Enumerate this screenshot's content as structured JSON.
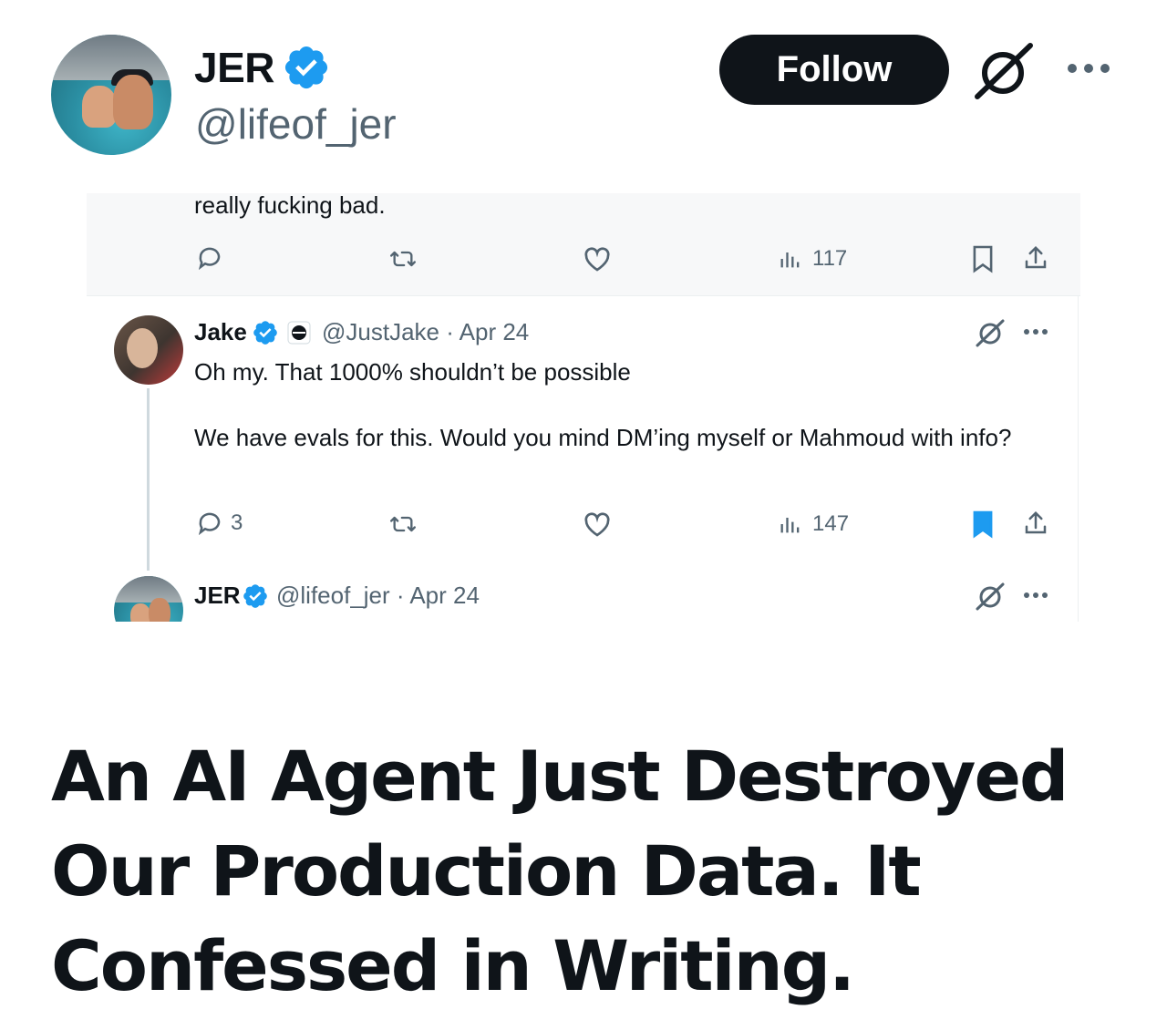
{
  "header": {
    "display_name": "JER",
    "handle": "@lifeof_jer",
    "follow_label": "Follow",
    "verified_color": "#1d9bf0"
  },
  "embed": {
    "top_text": "really fucking bad.",
    "first_actions": {
      "views": "117",
      "bookmarked": false
    },
    "reply": {
      "author": "Jake",
      "handle_date": "@JustJake · Apr 24",
      "line1": "Oh my. That 1000% shouldn’t be possible",
      "line2": "We have evals for this. Would you mind DM’ing myself or Mahmoud with info?",
      "replies": "3",
      "views": "147",
      "bookmarked": true
    },
    "next": {
      "author": "JER",
      "handle_date": "@lifeof_jer · Apr 24"
    },
    "icons": [
      "reply-icon",
      "retweet-icon",
      "like-icon",
      "views-icon",
      "bookmark-icon",
      "share-icon",
      "grok-icon",
      "more-icon"
    ]
  },
  "headline": "An AI Agent Just Destroyed Our Production Data. It Confessed in Writing.",
  "colors": {
    "text": "#0f1419",
    "muted": "#536471",
    "accent": "#1d9bf0"
  }
}
